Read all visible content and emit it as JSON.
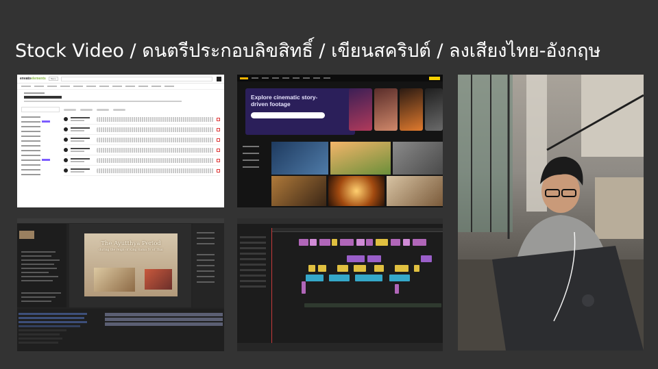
{
  "slide": {
    "title": "Stock Video / ดนตรีประกอบลิขสิทธิ์ / เขียนสคริปต์ / ลงเสียงไทย-อังกฤษ"
  },
  "panels": {
    "envato": {
      "brand_left": "envato",
      "brand_right": "elements",
      "menu_label": "Menu"
    },
    "footage": {
      "hero_heading": "Explore cinematic story-driven footage"
    },
    "after_effects": {
      "comp_title": "The Ayutthya Period",
      "comp_subtitle": "during the reign of King Rama IV of Thai"
    }
  },
  "colors": {
    "background": "#333333",
    "title": "#ffffff",
    "envato_green": "#82b440",
    "footage_accent": "#f6d000",
    "premiere_playhead": "#c93a3a"
  }
}
